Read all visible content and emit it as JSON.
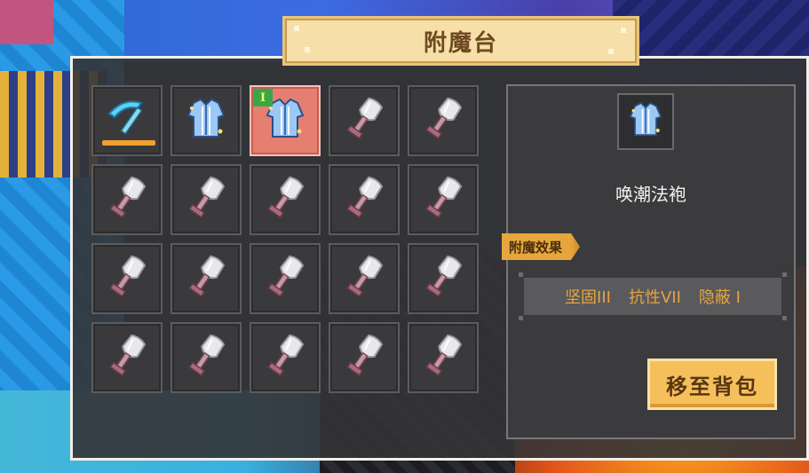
{
  "window": {
    "title": "附魔台"
  },
  "inventory": {
    "slots": [
      {
        "item": "pickaxe-icon",
        "selected": false,
        "durability": 1.0
      },
      {
        "item": "robe-icon",
        "selected": false
      },
      {
        "item": "robe-icon",
        "selected": true,
        "tier_label": "I"
      },
      {
        "item": "shovel-icon"
      },
      {
        "item": "shovel-icon"
      },
      {
        "item": "shovel-icon"
      },
      {
        "item": "shovel-icon"
      },
      {
        "item": "shovel-icon"
      },
      {
        "item": "shovel-icon"
      },
      {
        "item": "shovel-icon"
      },
      {
        "item": "shovel-icon"
      },
      {
        "item": "shovel-icon"
      },
      {
        "item": "shovel-icon"
      },
      {
        "item": "shovel-icon"
      },
      {
        "item": "shovel-icon"
      },
      {
        "item": "shovel-icon"
      },
      {
        "item": "shovel-icon"
      },
      {
        "item": "shovel-icon"
      },
      {
        "item": "shovel-icon"
      },
      {
        "item": "shovel-icon"
      }
    ]
  },
  "detail": {
    "item_icon": "robe-icon",
    "item_name": "唤潮法袍",
    "effects_label": "附魔效果",
    "effects": [
      "坚固III",
      "抗性VII",
      "隐蔽 I"
    ],
    "move_button": "移至背包"
  },
  "colors": {
    "accent": "#f5c05c",
    "effect_text": "#e6a440",
    "selected_slot": "#e57f72"
  }
}
